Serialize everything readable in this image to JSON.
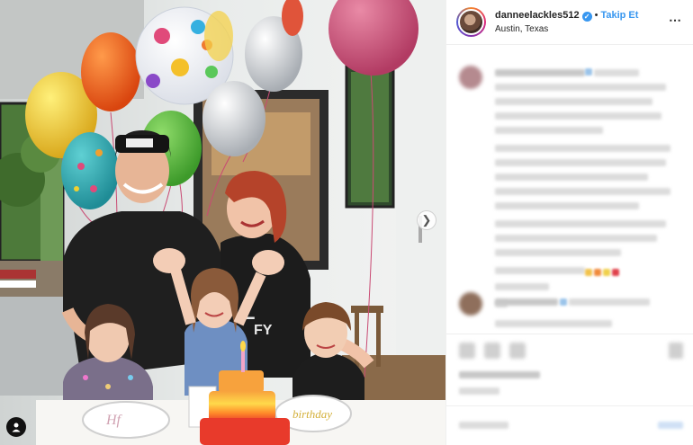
{
  "post": {
    "username": "danneelackles512",
    "verified_mark": "✓",
    "separator": "•",
    "follow_label": "Takip Et",
    "location": "Austin, Texas",
    "more_icon": "⋯"
  },
  "cake": {
    "plate_right_text": "birthday"
  },
  "icons": {
    "carousel_next": "chevron-right-icon",
    "tag": "user-tag-icon"
  },
  "colors": {
    "accent": "#3897f0",
    "text": "#262626",
    "border": "#efefef"
  }
}
